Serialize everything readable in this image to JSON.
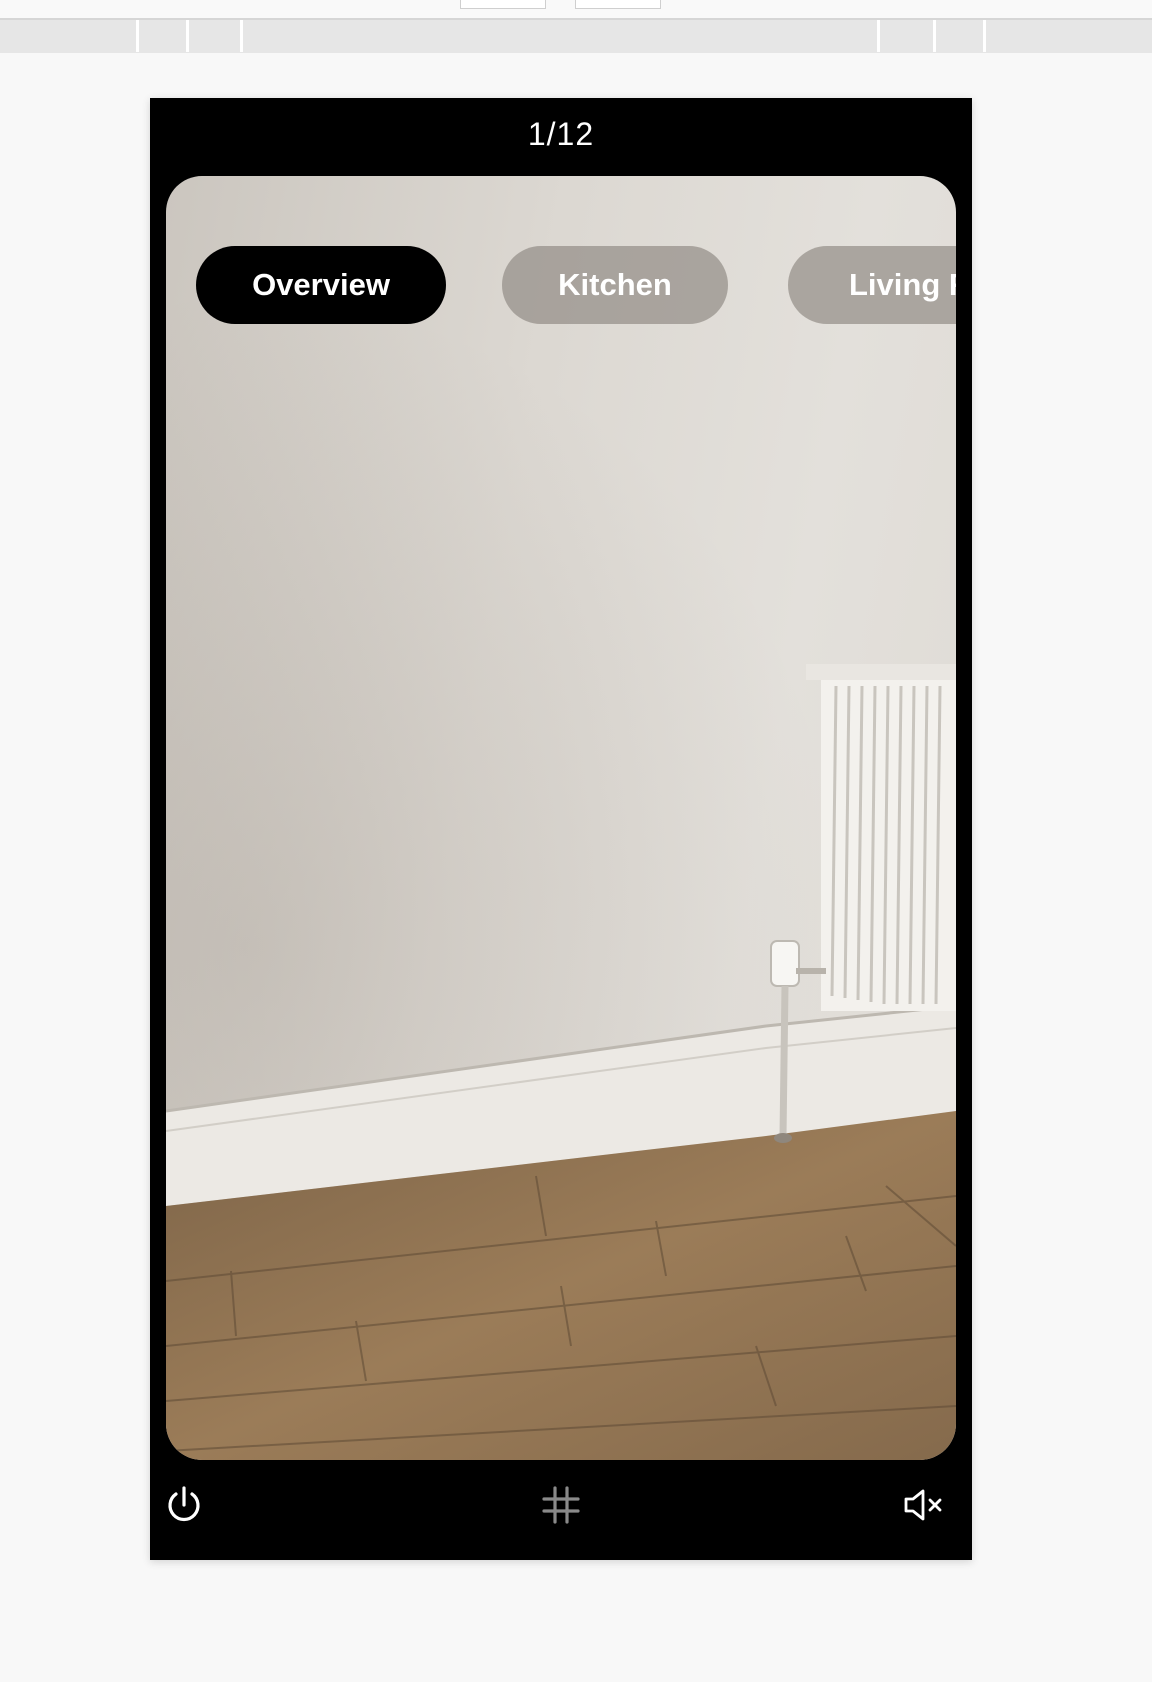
{
  "player": {
    "counter": "1/12",
    "tabs": [
      {
        "label": "Overview",
        "active": true
      },
      {
        "label": "Kitchen",
        "active": false
      },
      {
        "label": "Living R",
        "active": false
      }
    ]
  },
  "controls": {
    "power_icon": "power-icon",
    "grid_icon": "hash-grid-icon",
    "mute_icon": "volume-muted-icon"
  },
  "colors": {
    "player_bg": "#000000",
    "active_tab": "#000000",
    "inactive_tab": "#8c8680",
    "page_bg": "#f8f8f8"
  }
}
